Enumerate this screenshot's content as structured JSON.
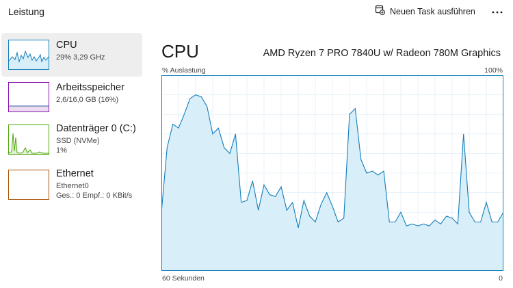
{
  "header": {
    "title": "Leistung",
    "new_task_label": "Neuen Task ausführen",
    "more_icon": "more-icon"
  },
  "sidebar": {
    "items": [
      {
        "title": "CPU",
        "line1": "29% 3,29 GHz",
        "line2": "",
        "selected": true,
        "color": "#117dbb"
      },
      {
        "title": "Arbeitsspeicher",
        "line1": "2,6/16,0 GB (16%)",
        "line2": "",
        "selected": false,
        "color": "#8b12ae"
      },
      {
        "title": "Datenträger 0 (C:)",
        "line1": "SSD (NVMe)",
        "line2": "1%",
        "selected": false,
        "color": "#4da60c"
      },
      {
        "title": "Ethernet",
        "line1": "Ethernet0",
        "line2": "Ges.: 0 Empf.: 0 KBit/s",
        "selected": false,
        "color": "#a74f01"
      }
    ]
  },
  "main": {
    "title": "CPU",
    "processor": "AMD Ryzen 7 PRO 7840U w/ Radeon 780M Graphics",
    "y_label": "% Auslastung",
    "y_max_label": "100%",
    "x_left_label": "60 Sekunden",
    "x_right_label": "0"
  },
  "colors": {
    "cpu_line": "#117dbb",
    "cpu_fill": "#d8eef8",
    "grid": "#d9eaf5",
    "border": "#117dbb"
  },
  "chart_data": {
    "type": "area",
    "ylabel": "% Auslastung",
    "xlabel": "60 Sekunden",
    "ylim": [
      0,
      100
    ],
    "xlim": [
      60,
      0
    ],
    "x": [
      60,
      59,
      58,
      57,
      56,
      55,
      54,
      53,
      52,
      51,
      50,
      49,
      48,
      47,
      46,
      45,
      44,
      43,
      42,
      41,
      40,
      39,
      38,
      37,
      36,
      35,
      34,
      33,
      32,
      31,
      30,
      29,
      28,
      27,
      26,
      25,
      24,
      23,
      22,
      21,
      20,
      19,
      18,
      17,
      16,
      15,
      14,
      13,
      12,
      11,
      10,
      9,
      8,
      7,
      6,
      5,
      4,
      3,
      2,
      1,
      0
    ],
    "values": [
      30,
      63,
      75,
      73,
      80,
      88,
      90,
      89,
      84,
      70,
      73,
      63,
      60,
      70,
      35,
      36,
      46,
      31,
      44,
      39,
      38,
      43,
      31,
      35,
      22,
      36,
      28,
      25,
      34,
      40,
      33,
      25,
      27,
      80,
      83,
      57,
      50,
      51,
      49,
      51,
      25,
      25,
      30,
      23,
      24,
      23,
      24,
      23,
      26,
      24,
      28,
      27,
      24,
      70,
      30,
      25,
      25,
      35,
      25,
      25,
      30
    ]
  }
}
